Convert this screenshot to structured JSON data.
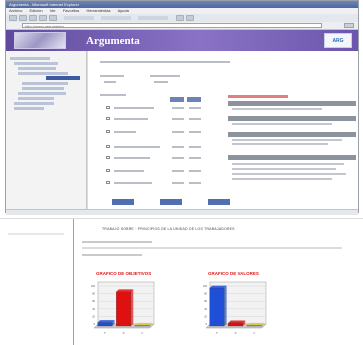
{
  "browser": {
    "title": "Argumenta - Microsoft Internet Explorer",
    "menu": [
      "Archivo",
      "Edición",
      "Ver",
      "Favoritos",
      "Herramientas",
      "Ayuda"
    ],
    "address": "http://www.argumenta..."
  },
  "banner": {
    "title": "Argumenta",
    "logo": "ARG"
  },
  "document": {
    "header": "TRABAJO SOBRE · PRINCIPIOS DE LA UNIDAD DE LOS TRABAJADORES",
    "charts": [
      {
        "title": "GRAFICO DE OBJETIVOS",
        "chart_data": {
          "type": "bar",
          "categories": [
            "A",
            "B",
            "C"
          ],
          "values": [
            9,
            90,
            2
          ],
          "colors": [
            "#1f4fd6",
            "#e01010",
            "#d9c84a"
          ],
          "ylim": [
            0,
            100
          ],
          "grid": true
        }
      },
      {
        "title": "GRAFICO DE VALORES",
        "chart_data": {
          "type": "bar",
          "categories": [
            "A",
            "B",
            "C"
          ],
          "values": [
            100,
            8,
            2
          ],
          "colors": [
            "#1f4fd6",
            "#e01010",
            "#d9c84a"
          ],
          "ylim": [
            0,
            100
          ],
          "grid": true
        }
      }
    ]
  }
}
